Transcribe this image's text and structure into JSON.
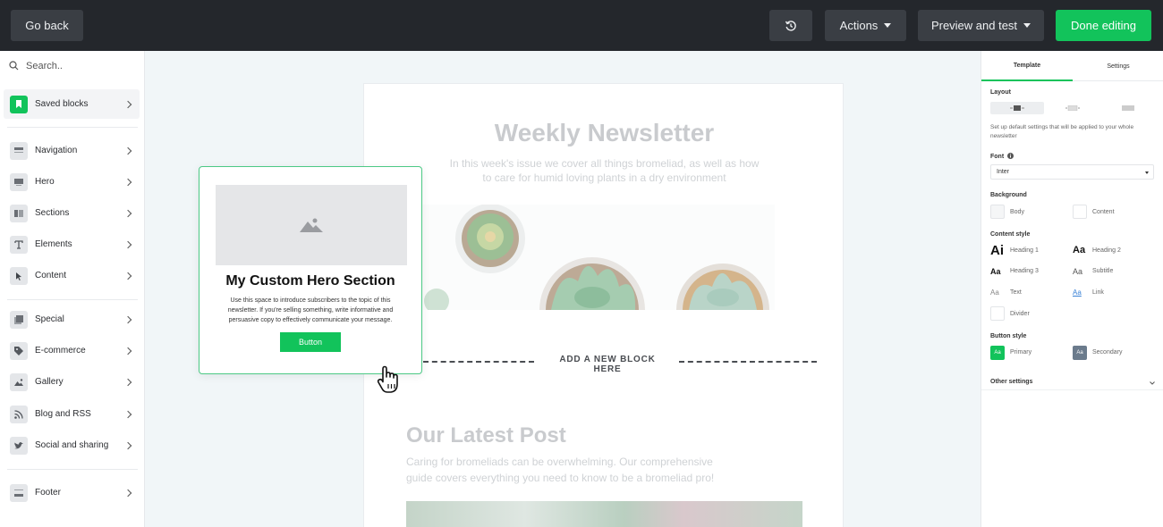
{
  "topbar": {
    "go_back": "Go back",
    "actions": "Actions",
    "preview": "Preview and test",
    "done": "Done editing"
  },
  "sidebar": {
    "search_placeholder": "Search..",
    "items": [
      {
        "label": "Saved blocks"
      },
      {
        "label": "Navigation"
      },
      {
        "label": "Hero"
      },
      {
        "label": "Sections"
      },
      {
        "label": "Elements"
      },
      {
        "label": "Content"
      },
      {
        "label": "Special"
      },
      {
        "label": "E-commerce"
      },
      {
        "label": "Gallery"
      },
      {
        "label": "Blog and RSS"
      },
      {
        "label": "Social and sharing"
      },
      {
        "label": "Footer"
      }
    ]
  },
  "email": {
    "title": "Weekly Newsletter",
    "subtitle": "In this week's issue we cover all things bromeliad, as well as how to care for humid loving plants in a dry environment",
    "add_block": "ADD A NEW BLOCK HERE",
    "post_title": "Our Latest Post",
    "post_body": "Caring for bromeliads can be overwhelming. Our comprehensive guide covers everything you need to know to be a bromeliad pro!"
  },
  "drag_card": {
    "title": "My Custom Hero Section",
    "body": "Use this space to introduce subscribers to the topic of this newsletter. If you're selling something, write informative and persuasive copy to effectively communicate your message.",
    "button": "Button"
  },
  "right_panel": {
    "tabs": [
      "Template",
      "Settings"
    ],
    "layout_label": "Layout",
    "layout_desc": "Set up default settings that will be applied to your whole newsletter",
    "font_label": "Font",
    "font_value": "Inter",
    "background_label": "Background",
    "bg_body": "Body",
    "bg_content": "Content",
    "content_style_label": "Content style",
    "styles": {
      "h1_icon": "Ai",
      "h1": "Heading 1",
      "h2_icon": "Aa",
      "h2": "Heading 2",
      "h3_icon": "Aa",
      "h3": "Heading 3",
      "sub_icon": "Aa",
      "subtitle": "Subtitle",
      "text_icon": "Aa",
      "text": "Text",
      "link_icon": "Aa",
      "link": "Link",
      "divider": "Divider"
    },
    "button_style_label": "Button style",
    "btn_icon": "Aa",
    "primary": "Primary",
    "secondary": "Secondary",
    "other_settings": "Other settings"
  },
  "colors": {
    "accent": "#12c35b",
    "topbar": "#24272c"
  }
}
